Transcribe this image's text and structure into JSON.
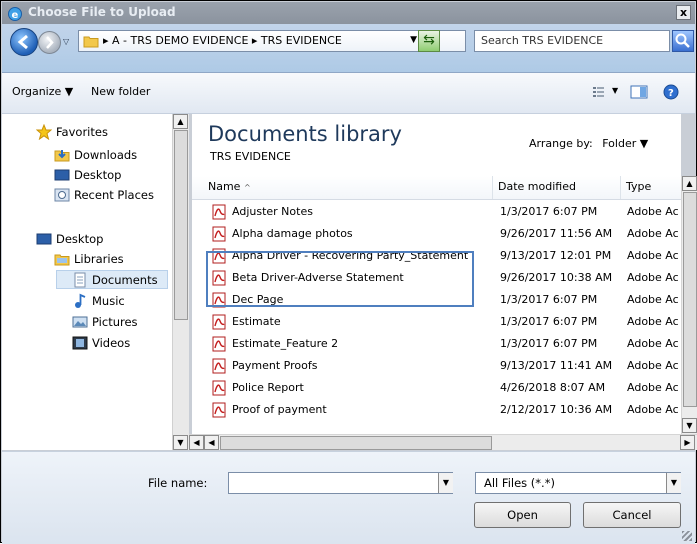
{
  "window": {
    "title": "Choose File to Upload",
    "close_label": "x"
  },
  "address_bar": {
    "breadcrumbs": "▸ A - TRS DEMO EVIDENCE ▸ TRS EVIDENCE",
    "search_placeholder": "Search TRS EVIDENCE"
  },
  "toolbar": {
    "organize_label": "Organize ▼",
    "new_folder_label": "New folder"
  },
  "nav": {
    "favorites": "Favorites",
    "downloads": "Downloads",
    "desktop_fav": "Desktop",
    "recent_places": "Recent Places",
    "desktop": "Desktop",
    "libraries": "Libraries",
    "documents": "Documents",
    "music": "Music",
    "pictures": "Pictures",
    "videos": "Videos"
  },
  "library": {
    "title": "Documents library",
    "subtitle": "TRS EVIDENCE",
    "arrange_label": "Arrange by:",
    "arrange_value": "Folder ▼"
  },
  "columns": {
    "name": "Name",
    "date": "Date modified",
    "type": "Type"
  },
  "files": [
    {
      "name": "Adjuster Notes",
      "date": "1/3/2017 6:07 PM",
      "type": "Adobe Ac"
    },
    {
      "name": "Alpha damage photos",
      "date": "9/26/2017 11:56 AM",
      "type": "Adobe Ac"
    },
    {
      "name": "Alpha Driver - Recovering Party_Statement",
      "date": "9/13/2017 12:01 PM",
      "type": "Adobe Ac"
    },
    {
      "name": "Beta Driver-Adverse Statement",
      "date": "9/26/2017 10:38 AM",
      "type": "Adobe Ac"
    },
    {
      "name": "Dec Page",
      "date": "1/3/2017 6:07 PM",
      "type": "Adobe Ac"
    },
    {
      "name": "Estimate",
      "date": "1/3/2017 6:07 PM",
      "type": "Adobe Ac"
    },
    {
      "name": "Estimate_Feature 2",
      "date": "1/3/2017 6:07 PM",
      "type": "Adobe Ac"
    },
    {
      "name": "Payment Proofs",
      "date": "9/13/2017 11:41 AM",
      "type": "Adobe Ac"
    },
    {
      "name": "Police Report",
      "date": "4/26/2018 8:07 AM",
      "type": "Adobe Ac"
    },
    {
      "name": "Proof of payment",
      "date": "2/12/2017 10:36 AM",
      "type": "Adobe Ac"
    }
  ],
  "footer": {
    "file_name_label": "File name:",
    "file_name_value": "",
    "file_type_value": "All Files (*.*)",
    "open_label": "Open",
    "cancel_label": "Cancel"
  },
  "colors": {
    "title_bar": "#9aa2ad",
    "address_bar": "#b8cfe8",
    "highlight_box": "#4f7fbf",
    "library_title": "#1e395b"
  }
}
